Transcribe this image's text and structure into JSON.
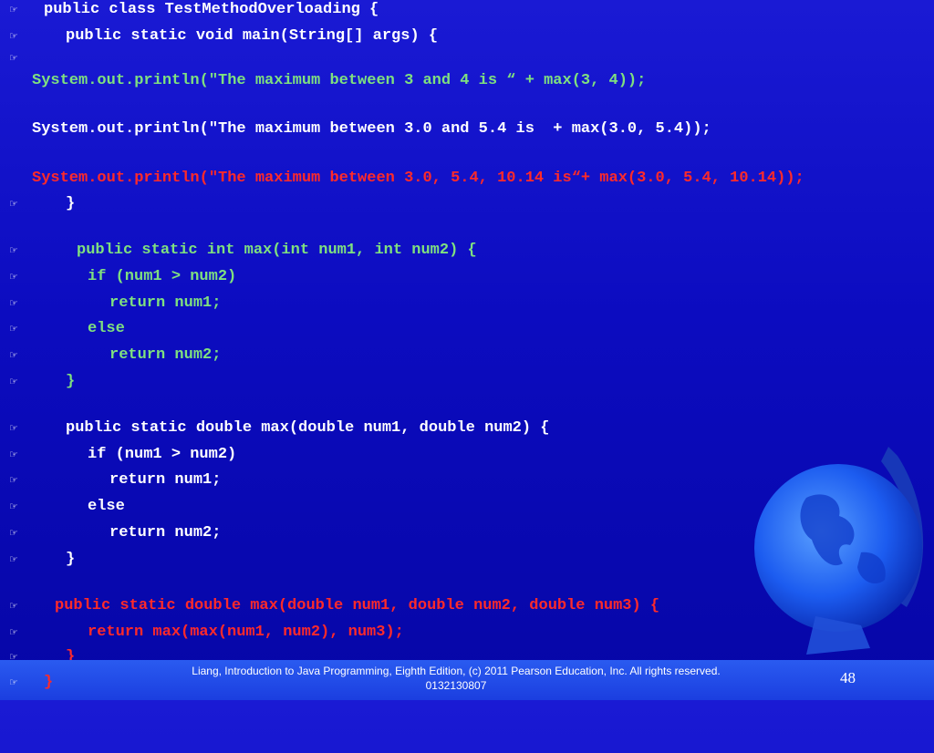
{
  "bullet_icon": "pointing-hand-icon",
  "colors": {
    "white": "#ffffff",
    "green": "#7fe07f",
    "red": "#ff2a2a",
    "background": "#0c0cc0",
    "footer": "#1b3ee0"
  },
  "code": {
    "l1": "public class TestMethodOverloading {",
    "l2": "public static void main(String[] args) {",
    "l4": "System.out.println(\"The maximum between 3 and 4 is “ + max(3, 4));",
    "l5": "System.out.println(\"The maximum between 3.0 and 5.4 is  + max(3.0, 5.4));",
    "l6": "System.out.println(\"The maximum between 3.0, 5.4, 10.14 is“+ max(3.0, 5.4, 10.14));",
    "l7": "}",
    "l8": "public static int max(int num1, int num2) {",
    "l9": "if (num1 > num2)",
    "l10": "return num1;",
    "l11": "else",
    "l12": "return num2;",
    "l13": "}",
    "l14": "public static double max(double num1, double num2) {",
    "l15": "if (num1 > num2)",
    "l16": "return num1;",
    "l17": "else",
    "l18": "return num2;",
    "l19": "}",
    "l20": "public static double max(double num1, double num2, double num3) {",
    "l21": "return max(max(num1, num2), num3);",
    "l22": "}",
    "l23": "}"
  },
  "footer": {
    "citation": "Liang, Introduction to Java Programming, Eighth Edition, (c) 2011 Pearson Education, Inc. All rights reserved. 0132130807",
    "page_number": "48"
  }
}
